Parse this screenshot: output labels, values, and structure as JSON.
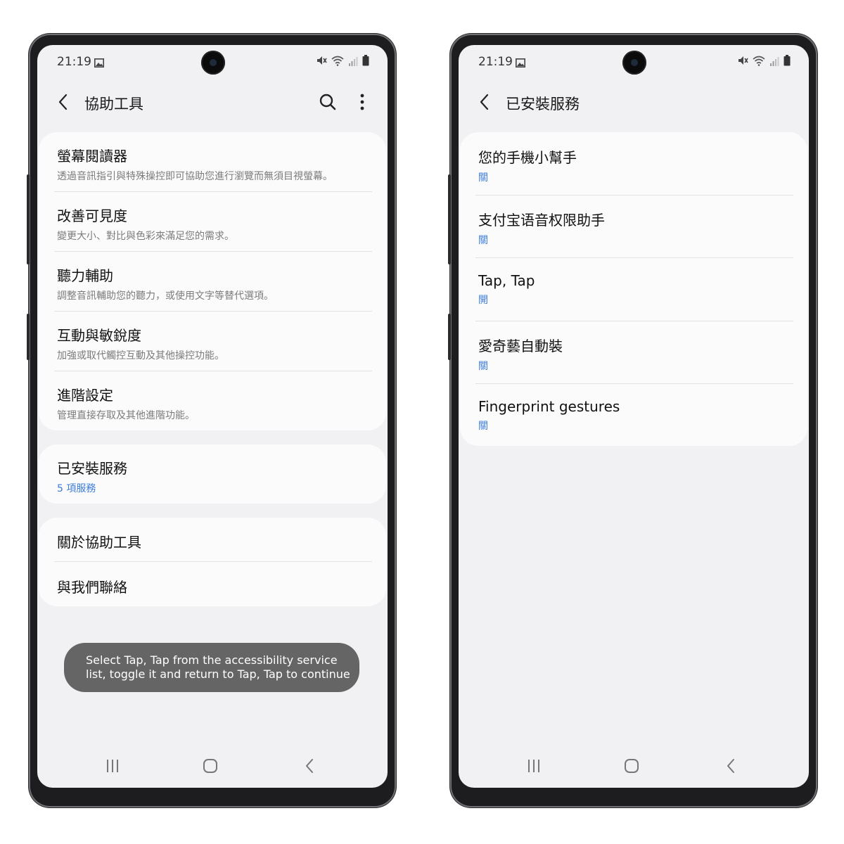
{
  "left": {
    "status": {
      "time": "21:19"
    },
    "appbar": {
      "title": "協助工具"
    },
    "sections": [
      {
        "items": [
          {
            "title": "螢幕閱讀器",
            "subtitle": "透過音訊指引與特殊操控即可協助您進行瀏覽而無須目視螢幕。"
          },
          {
            "title": "改善可見度",
            "subtitle": "變更大小、對比與色彩來滿足您的需求。"
          },
          {
            "title": "聽力輔助",
            "subtitle": "調整音訊輔助您的聽力，或使用文字等替代選項。"
          },
          {
            "title": "互動與敏銳度",
            "subtitle": "加強或取代觸控互動及其他操控功能。"
          },
          {
            "title": "進階設定",
            "subtitle": "管理直接存取及其他進階功能。"
          }
        ]
      },
      {
        "items": [
          {
            "title": "已安裝服務",
            "subtitle": "5 項服務"
          }
        ]
      },
      {
        "items": [
          {
            "title": "關於協助工具"
          },
          {
            "title": "與我們聯絡"
          }
        ]
      }
    ],
    "toast": {
      "line1": "Select Tap, Tap from the accessibility service",
      "line2": "list, toggle it and return to Tap, Tap to continue"
    }
  },
  "right": {
    "status": {
      "time": "21:19"
    },
    "appbar": {
      "title": "已安裝服務"
    },
    "services": [
      {
        "title": "您的手機小幫手",
        "state": "關"
      },
      {
        "title": "支付宝语音权限助手",
        "state": "關"
      },
      {
        "title": "Tap, Tap",
        "state": "開"
      },
      {
        "title": "愛奇藝自動裝",
        "state": "關"
      },
      {
        "title": "Fingerprint gestures",
        "state": "關"
      }
    ]
  },
  "colors": {
    "accent": "#3b7dd8",
    "screen_bg": "#f1f1f3",
    "card_bg": "#fbfbfc",
    "toast_bg": "#656565",
    "phone_body": "#1d1d1f"
  },
  "icons": [
    "gallery-icon",
    "mute-icon",
    "wifi-icon",
    "signal-icon",
    "battery-icon",
    "back-arrow-icon",
    "search-icon",
    "more-vert-icon",
    "recents-icon",
    "home-icon",
    "nav-back-icon"
  ]
}
